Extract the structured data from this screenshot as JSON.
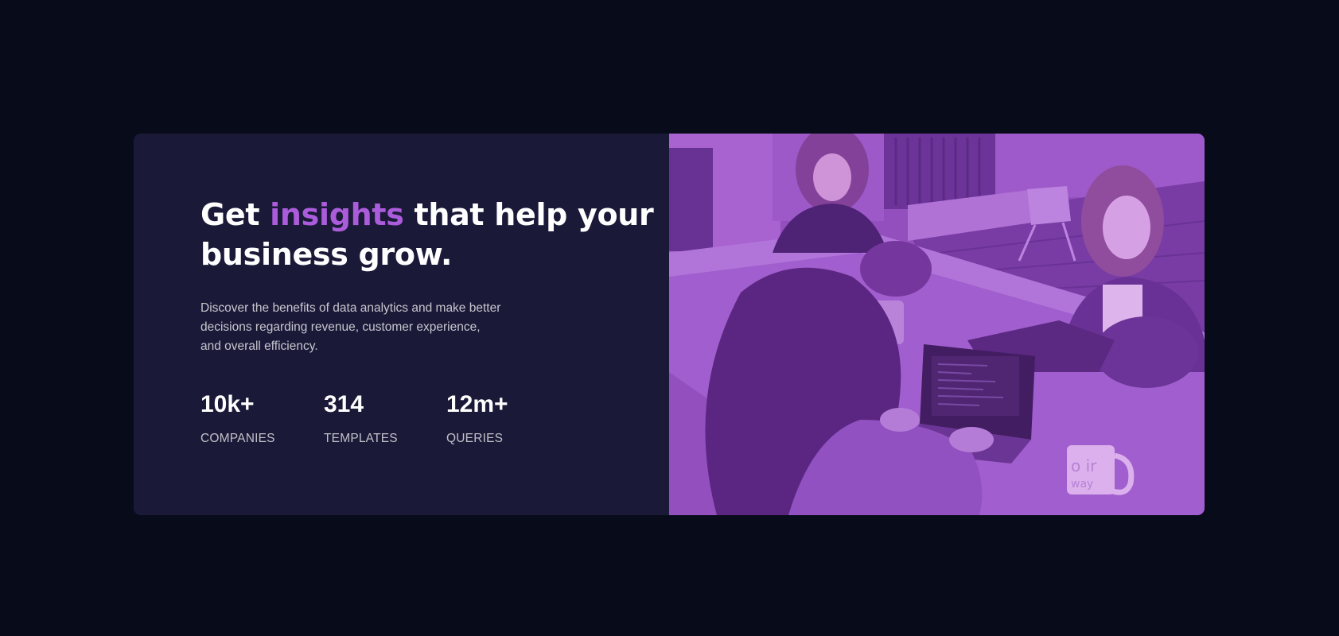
{
  "card": {
    "headline_part1": "Get ",
    "headline_accent": "insights",
    "headline_part2": " that help your business grow.",
    "description": "Discover the benefits of data analytics and make better decisions regarding revenue, customer experience, and overall efficiency.",
    "stats": [
      {
        "value": "10k+",
        "label": "COMPANIES"
      },
      {
        "value": "314",
        "label": "TEMPLATES"
      },
      {
        "value": "12m+",
        "label": "QUERIES"
      }
    ]
  },
  "colors": {
    "page_background": "#080b1a",
    "card_background": "#1b1938",
    "accent": "#ab5cdb",
    "image_overlay": "#aa5cdb"
  },
  "image": {
    "mug_text": "o ir\nway"
  }
}
